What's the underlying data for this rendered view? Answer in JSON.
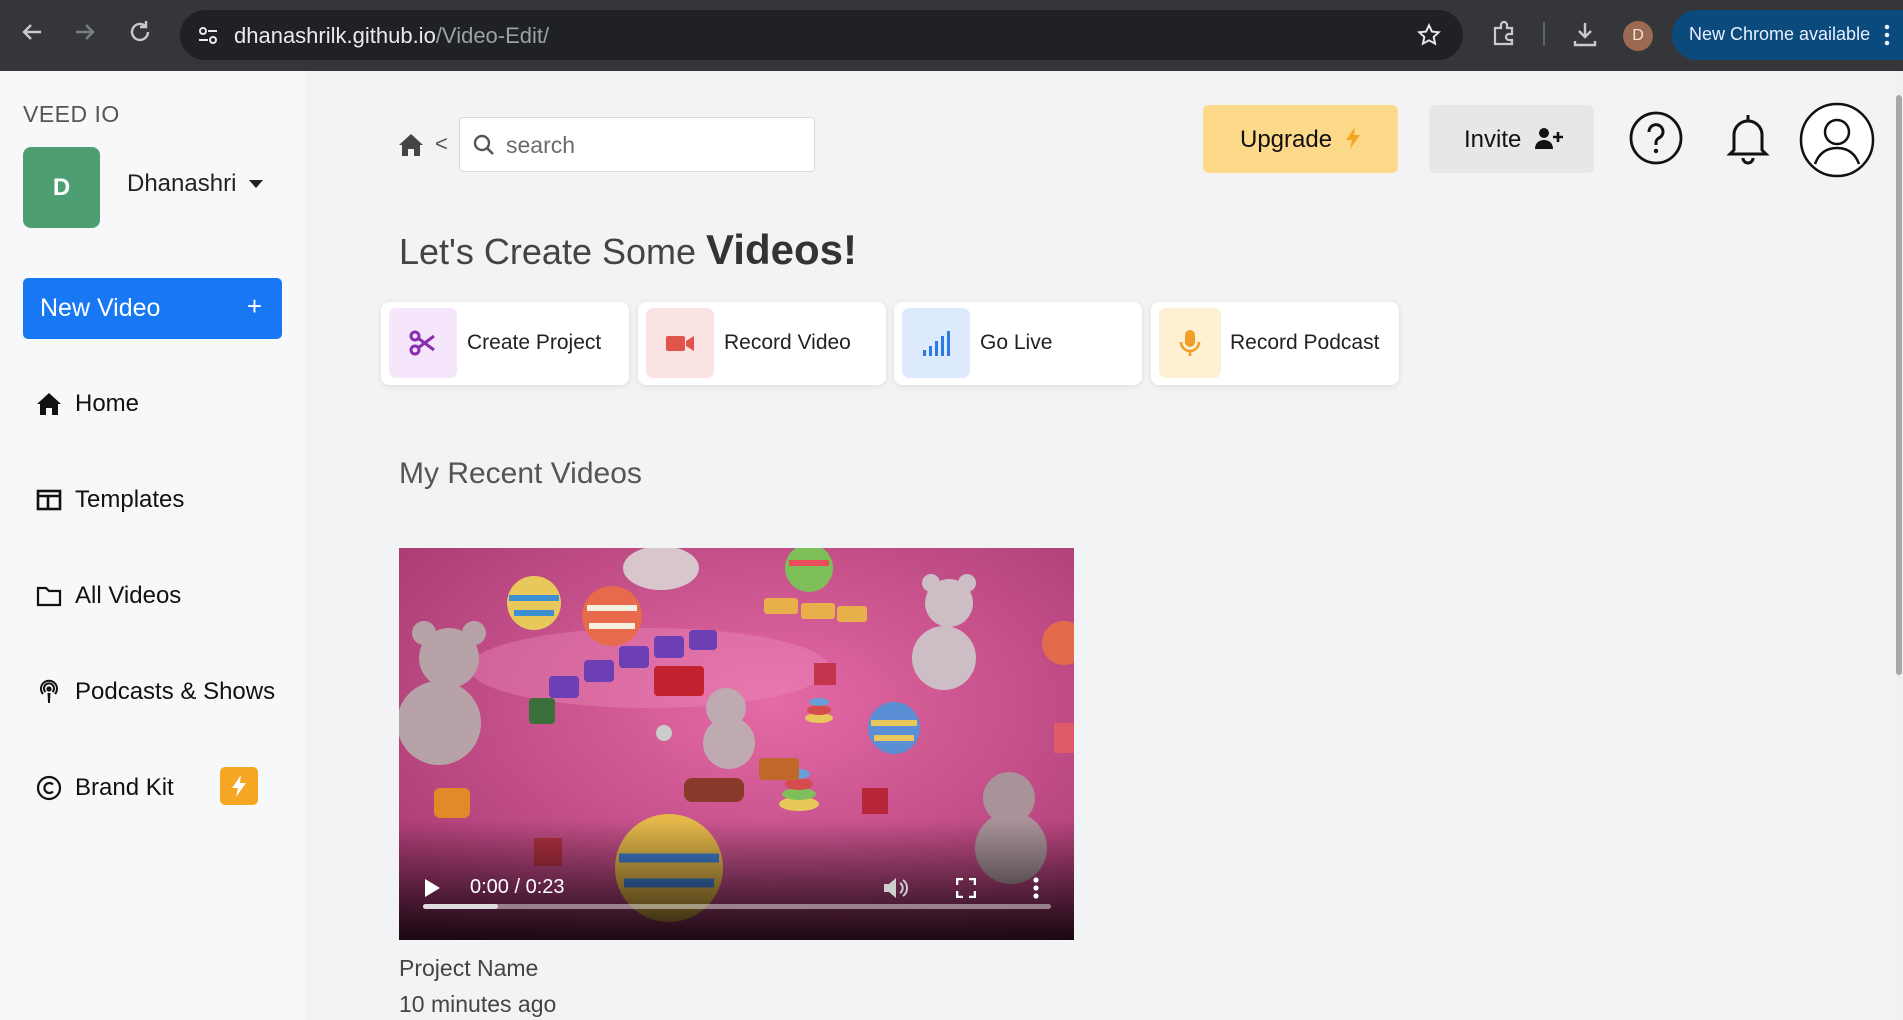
{
  "browser": {
    "url_host": "dhanashrilk.github.io",
    "url_path": "/Video-Edit/",
    "profile_initial": "D",
    "update_label": "New Chrome available"
  },
  "sidebar": {
    "brand": "VEED IO",
    "avatar_initial": "D",
    "username": "Dhanashri",
    "new_video_label": "New Video",
    "new_video_plus": "+",
    "items": [
      {
        "label": "Home",
        "icon": "home-icon"
      },
      {
        "label": "Templates",
        "icon": "templates-icon"
      },
      {
        "label": "All Videos",
        "icon": "folder-icon"
      },
      {
        "label": "Podcasts & Shows",
        "icon": "podcast-icon"
      },
      {
        "label": "Brand Kit",
        "icon": "copyright-icon"
      }
    ]
  },
  "header": {
    "back_symbol": "<",
    "search_placeholder": "search",
    "upgrade_label": "Upgrade",
    "invite_label": "Invite"
  },
  "main": {
    "greeting_prefix": "Let's Create Some",
    "greeting_emphasis": "Videos!",
    "quick_actions": [
      {
        "label": "Create Project",
        "icon": "scissors-icon",
        "tint": "#f6e6fb",
        "color": "#8a2eb0"
      },
      {
        "label": "Record Video",
        "icon": "video-camera-icon",
        "tint": "#fbe3e3",
        "color": "#e0554b"
      },
      {
        "label": "Go Live",
        "icon": "signal-icon",
        "tint": "#dde9fd",
        "color": "#2c7be5"
      },
      {
        "label": "Record Podcast",
        "icon": "microphone-icon",
        "tint": "#fdf0d3",
        "color": "#f0a028"
      }
    ],
    "recent_title": "My Recent Videos",
    "video": {
      "time_display": "0:00 / 0:23",
      "progress": 0.12
    },
    "project_name": "Project Name",
    "project_time": "10 minutes ago"
  }
}
